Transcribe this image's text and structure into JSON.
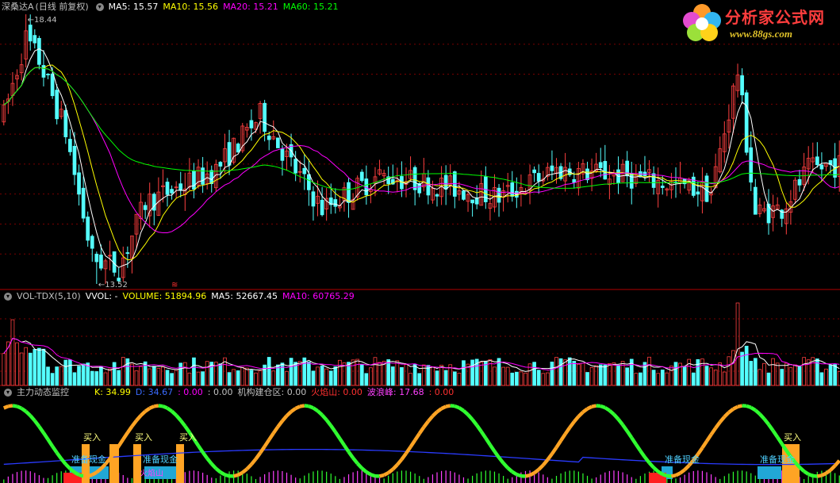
{
  "price_panel": {
    "title": "深桑达A",
    "adjust": "(日线 前复权)",
    "indicators": [
      {
        "label": "MA5: 15.57",
        "color": "#ffffff"
      },
      {
        "label": "MA10: 15.56",
        "color": "#ffff00"
      },
      {
        "label": "MA20: 15.21",
        "color": "#ff00ff"
      },
      {
        "label": "MA60: 15.21",
        "color": "#00ff00"
      }
    ],
    "high_label": "18.44",
    "low_label": "13.52",
    "marker_glyph": "≋"
  },
  "volume_panel": {
    "title": "VOL-TDX(5,10)",
    "indicators": [
      {
        "label": "VVOL: -",
        "color": "#ffffff"
      },
      {
        "label": "VOLUME: 51894.96",
        "color": "#ffff00"
      },
      {
        "label": "MA5: 52667.45",
        "color": "#ffffff"
      },
      {
        "label": "MA10: 60765.29",
        "color": "#ff00ff"
      }
    ]
  },
  "indicator_panel": {
    "title": "主力动态监控",
    "indicators": [
      {
        "label": "K: 34.99",
        "color": "#ffff00"
      },
      {
        "label": "D: 34.67",
        "color": "#3a6bff"
      },
      {
        "label": ": 0.00",
        "color": "#ff00ff"
      },
      {
        "label": ": 0.00",
        "color": "#c0c0c0"
      },
      {
        "label": "机构建仓区: 0.00",
        "color": "#c0c0c0"
      },
      {
        "label": "火焰山: 0.00",
        "color": "#ff3030"
      },
      {
        "label": "波浪峰: 17.68",
        "color": "#ff40ff"
      },
      {
        "label": ": 0.00",
        "color": "#ff3030"
      }
    ],
    "signal_text": {
      "buy": "买入",
      "prepare": "准备现金",
      "hot": "火焰山"
    }
  },
  "logo": {
    "name": "分析家公式网",
    "url": "www.88gs.com"
  },
  "colors": {
    "up": "#ff4040",
    "down": "#54ffff",
    "ma5": "#ffffff",
    "ma10": "#ffff00",
    "ma20": "#ff00ff",
    "ma60": "#00ff00",
    "grid": "#7a0000"
  },
  "chart_data": {
    "type": "candlestick",
    "bars": 190,
    "price_range": [
      13.52,
      18.44
    ],
    "current": {
      "MA5": 15.57,
      "MA10": 15.56,
      "MA20": 15.21,
      "MA60": 15.21
    },
    "volume": {
      "VOLUME": 51894.96,
      "MA5": 52667.45,
      "MA10": 60765.29
    },
    "kd": {
      "K": 34.99,
      "D": 34.67
    },
    "wave_peak": 17.68
  }
}
